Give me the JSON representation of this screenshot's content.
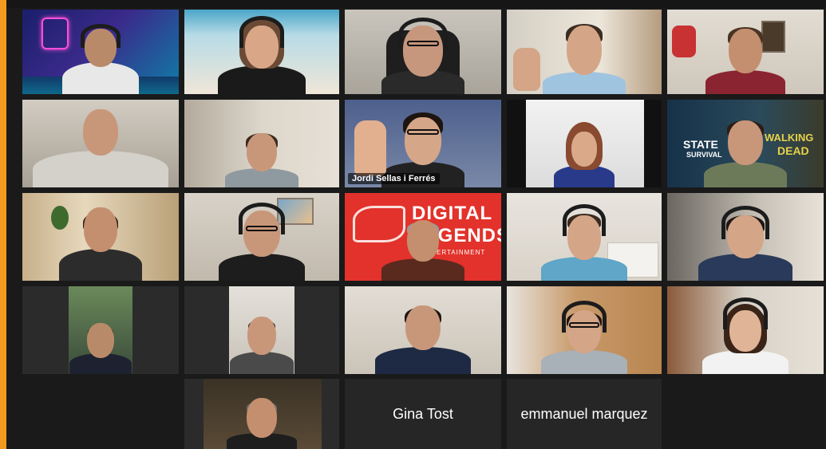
{
  "meeting": {
    "active_speaker": "Jordi Sellas i Ferrés",
    "participants": [
      {
        "id": "p01",
        "name": "",
        "video": true
      },
      {
        "id": "p02",
        "name": "",
        "video": true
      },
      {
        "id": "p03",
        "name": "",
        "video": true
      },
      {
        "id": "p04",
        "name": "",
        "video": true
      },
      {
        "id": "p05",
        "name": "",
        "video": true
      },
      {
        "id": "p06",
        "name": "",
        "video": true
      },
      {
        "id": "p07",
        "name": "",
        "video": true
      },
      {
        "id": "p08",
        "name": "Jordi Sellas i Ferrés",
        "video": true,
        "active": true
      },
      {
        "id": "p09",
        "name": "",
        "video": true
      },
      {
        "id": "p10",
        "name": "",
        "video": true
      },
      {
        "id": "p11",
        "name": "",
        "video": true
      },
      {
        "id": "p12",
        "name": "",
        "video": true
      },
      {
        "id": "p13",
        "name": "",
        "video": true
      },
      {
        "id": "p14",
        "name": "",
        "video": true
      },
      {
        "id": "p15",
        "name": "",
        "video": true
      },
      {
        "id": "p16",
        "name": "",
        "video": true
      },
      {
        "id": "p17",
        "name": "",
        "video": true
      },
      {
        "id": "p18",
        "name": "",
        "video": true
      },
      {
        "id": "p19",
        "name": "",
        "video": true
      },
      {
        "id": "p20",
        "name": "",
        "video": true
      },
      {
        "id": "p21",
        "name": "",
        "video": true
      },
      {
        "id": "p22",
        "name": "Gina Tost",
        "video": false
      },
      {
        "id": "p23",
        "name": "emmanuel marquez",
        "video": false
      }
    ]
  },
  "backgrounds": {
    "digital_legends": {
      "line1": "DIGITAL",
      "line2": "LEGENDS",
      "line3": "ENTERTAINMENT"
    },
    "state_of_survival": {
      "line1": "STATE",
      "line2": "SURVIVAL",
      "line3": "WALKING",
      "line4": "DEAD"
    }
  },
  "colors": {
    "accent": "#f29a1f",
    "active_border": "#c8e04a",
    "digital_legends_red": "#e2322b"
  }
}
